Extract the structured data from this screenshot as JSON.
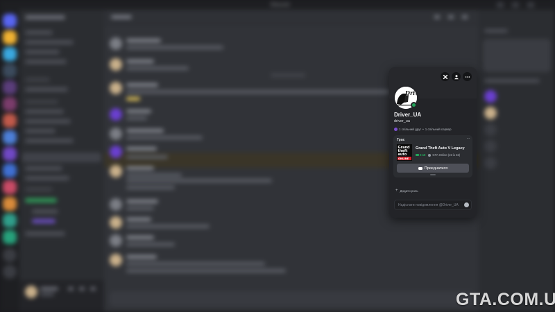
{
  "window": {
    "title": "Discord"
  },
  "profile": {
    "display_name": "Driver_UA",
    "username": "driver_ua",
    "mutual_friends": "1 спільний друг",
    "mutual_servers": "1 спільний сервер",
    "status": "online",
    "status_color": "#23a55a",
    "avatar_text": "Driver"
  },
  "activity": {
    "section_label": "Грає",
    "game_title": "Grand Theft Auto V Legacy",
    "elapsed": "0:18",
    "party": "GTA Online (23 із 32)",
    "join_label": "Приєднатися",
    "cover_lines": [
      "Grand",
      "theft",
      "auto",
      "ONLINE"
    ]
  },
  "actions": {
    "add_role": "Додати роль",
    "message_placeholder": "Надіслати повідомлення @Driver_UA"
  },
  "icons": [
    "xbox-icon",
    "add-friend-icon",
    "more-icon",
    "controller-icon",
    "people-icon",
    "emoji-icon",
    "plus-icon"
  ],
  "watermark": "GTA.COM.UA"
}
